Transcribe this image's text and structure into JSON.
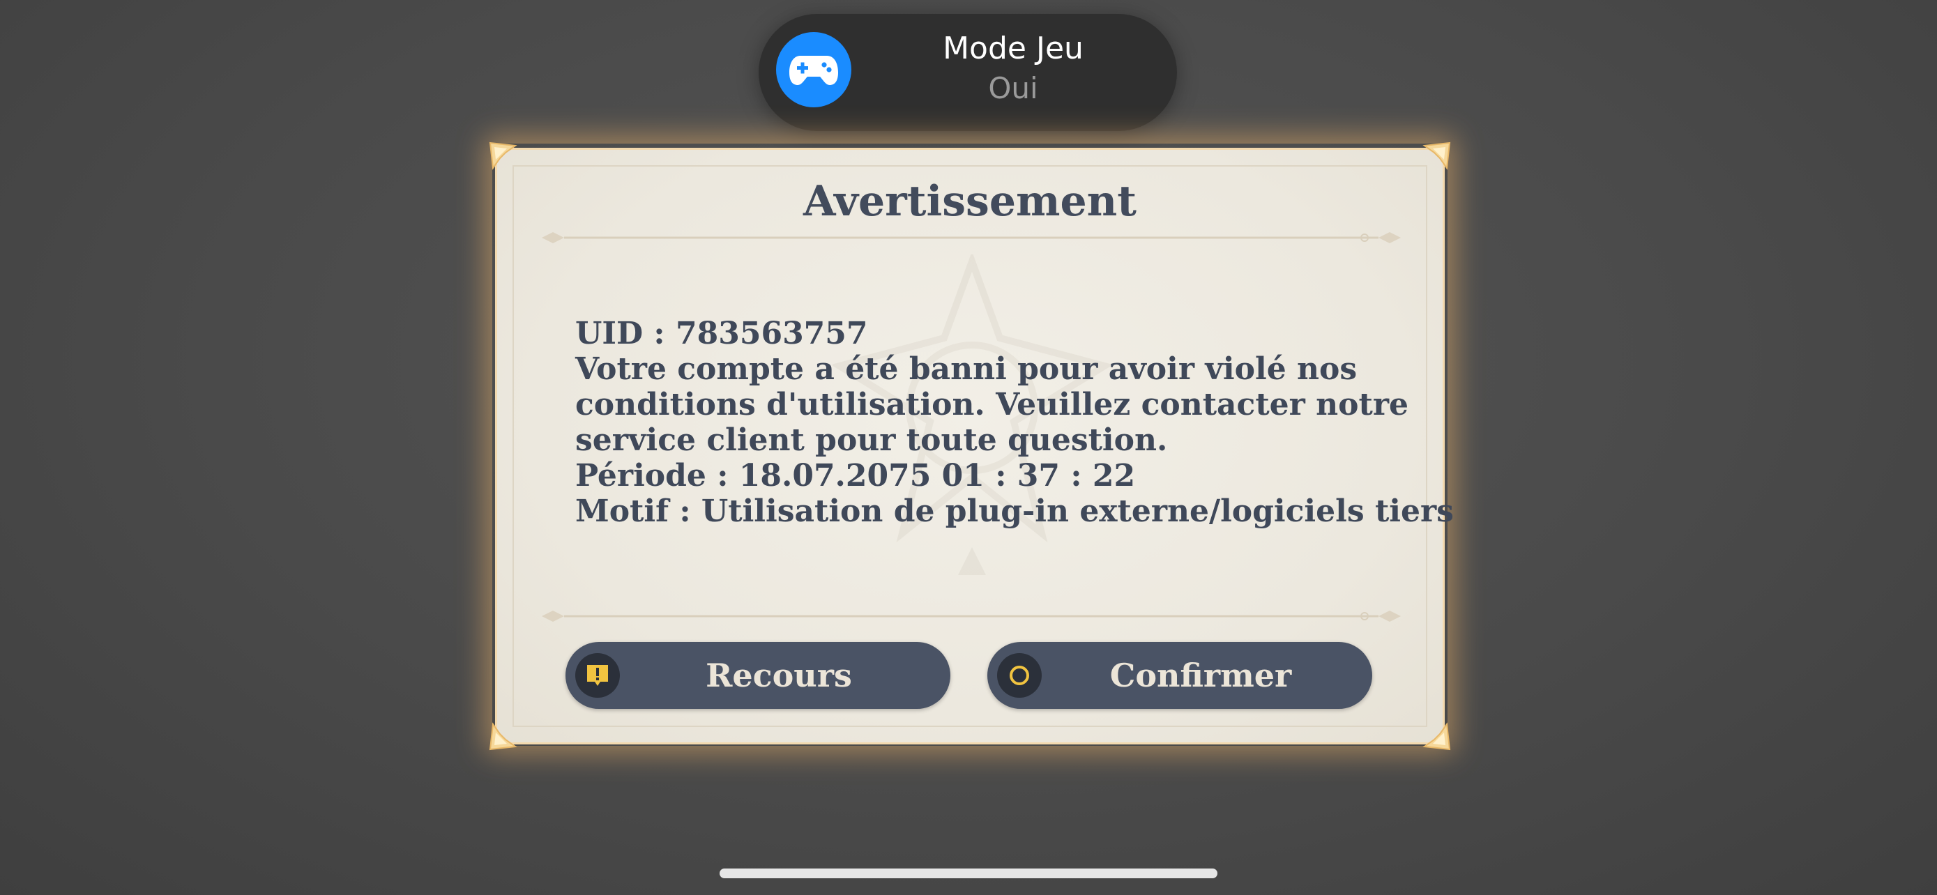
{
  "game_mode_banner": {
    "icon": "gamepad-icon",
    "title": "Mode Jeu",
    "status": "Oui",
    "accent_color": "#1a8cff"
  },
  "dialog": {
    "title": "Avertissement",
    "body_lines": [
      "UID : 783563757",
      "Votre compte a été banni pour avoir violé nos",
      "conditions d'utilisation. Veuillez contacter notre",
      "service client pour toute question.",
      "Période : 18.07.2075 01 : 37 : 22",
      "Motif : Utilisation de plug-in externe/logiciels tiers"
    ],
    "buttons": {
      "appeal": {
        "label": "Recours",
        "icon": "exclamation-icon",
        "icon_color": "#f2c440"
      },
      "confirm": {
        "label": "Confirmer",
        "icon": "circle-icon",
        "icon_color": "#f2c440"
      }
    },
    "text_color": "#424b5c",
    "button_color": "#4a5365"
  }
}
